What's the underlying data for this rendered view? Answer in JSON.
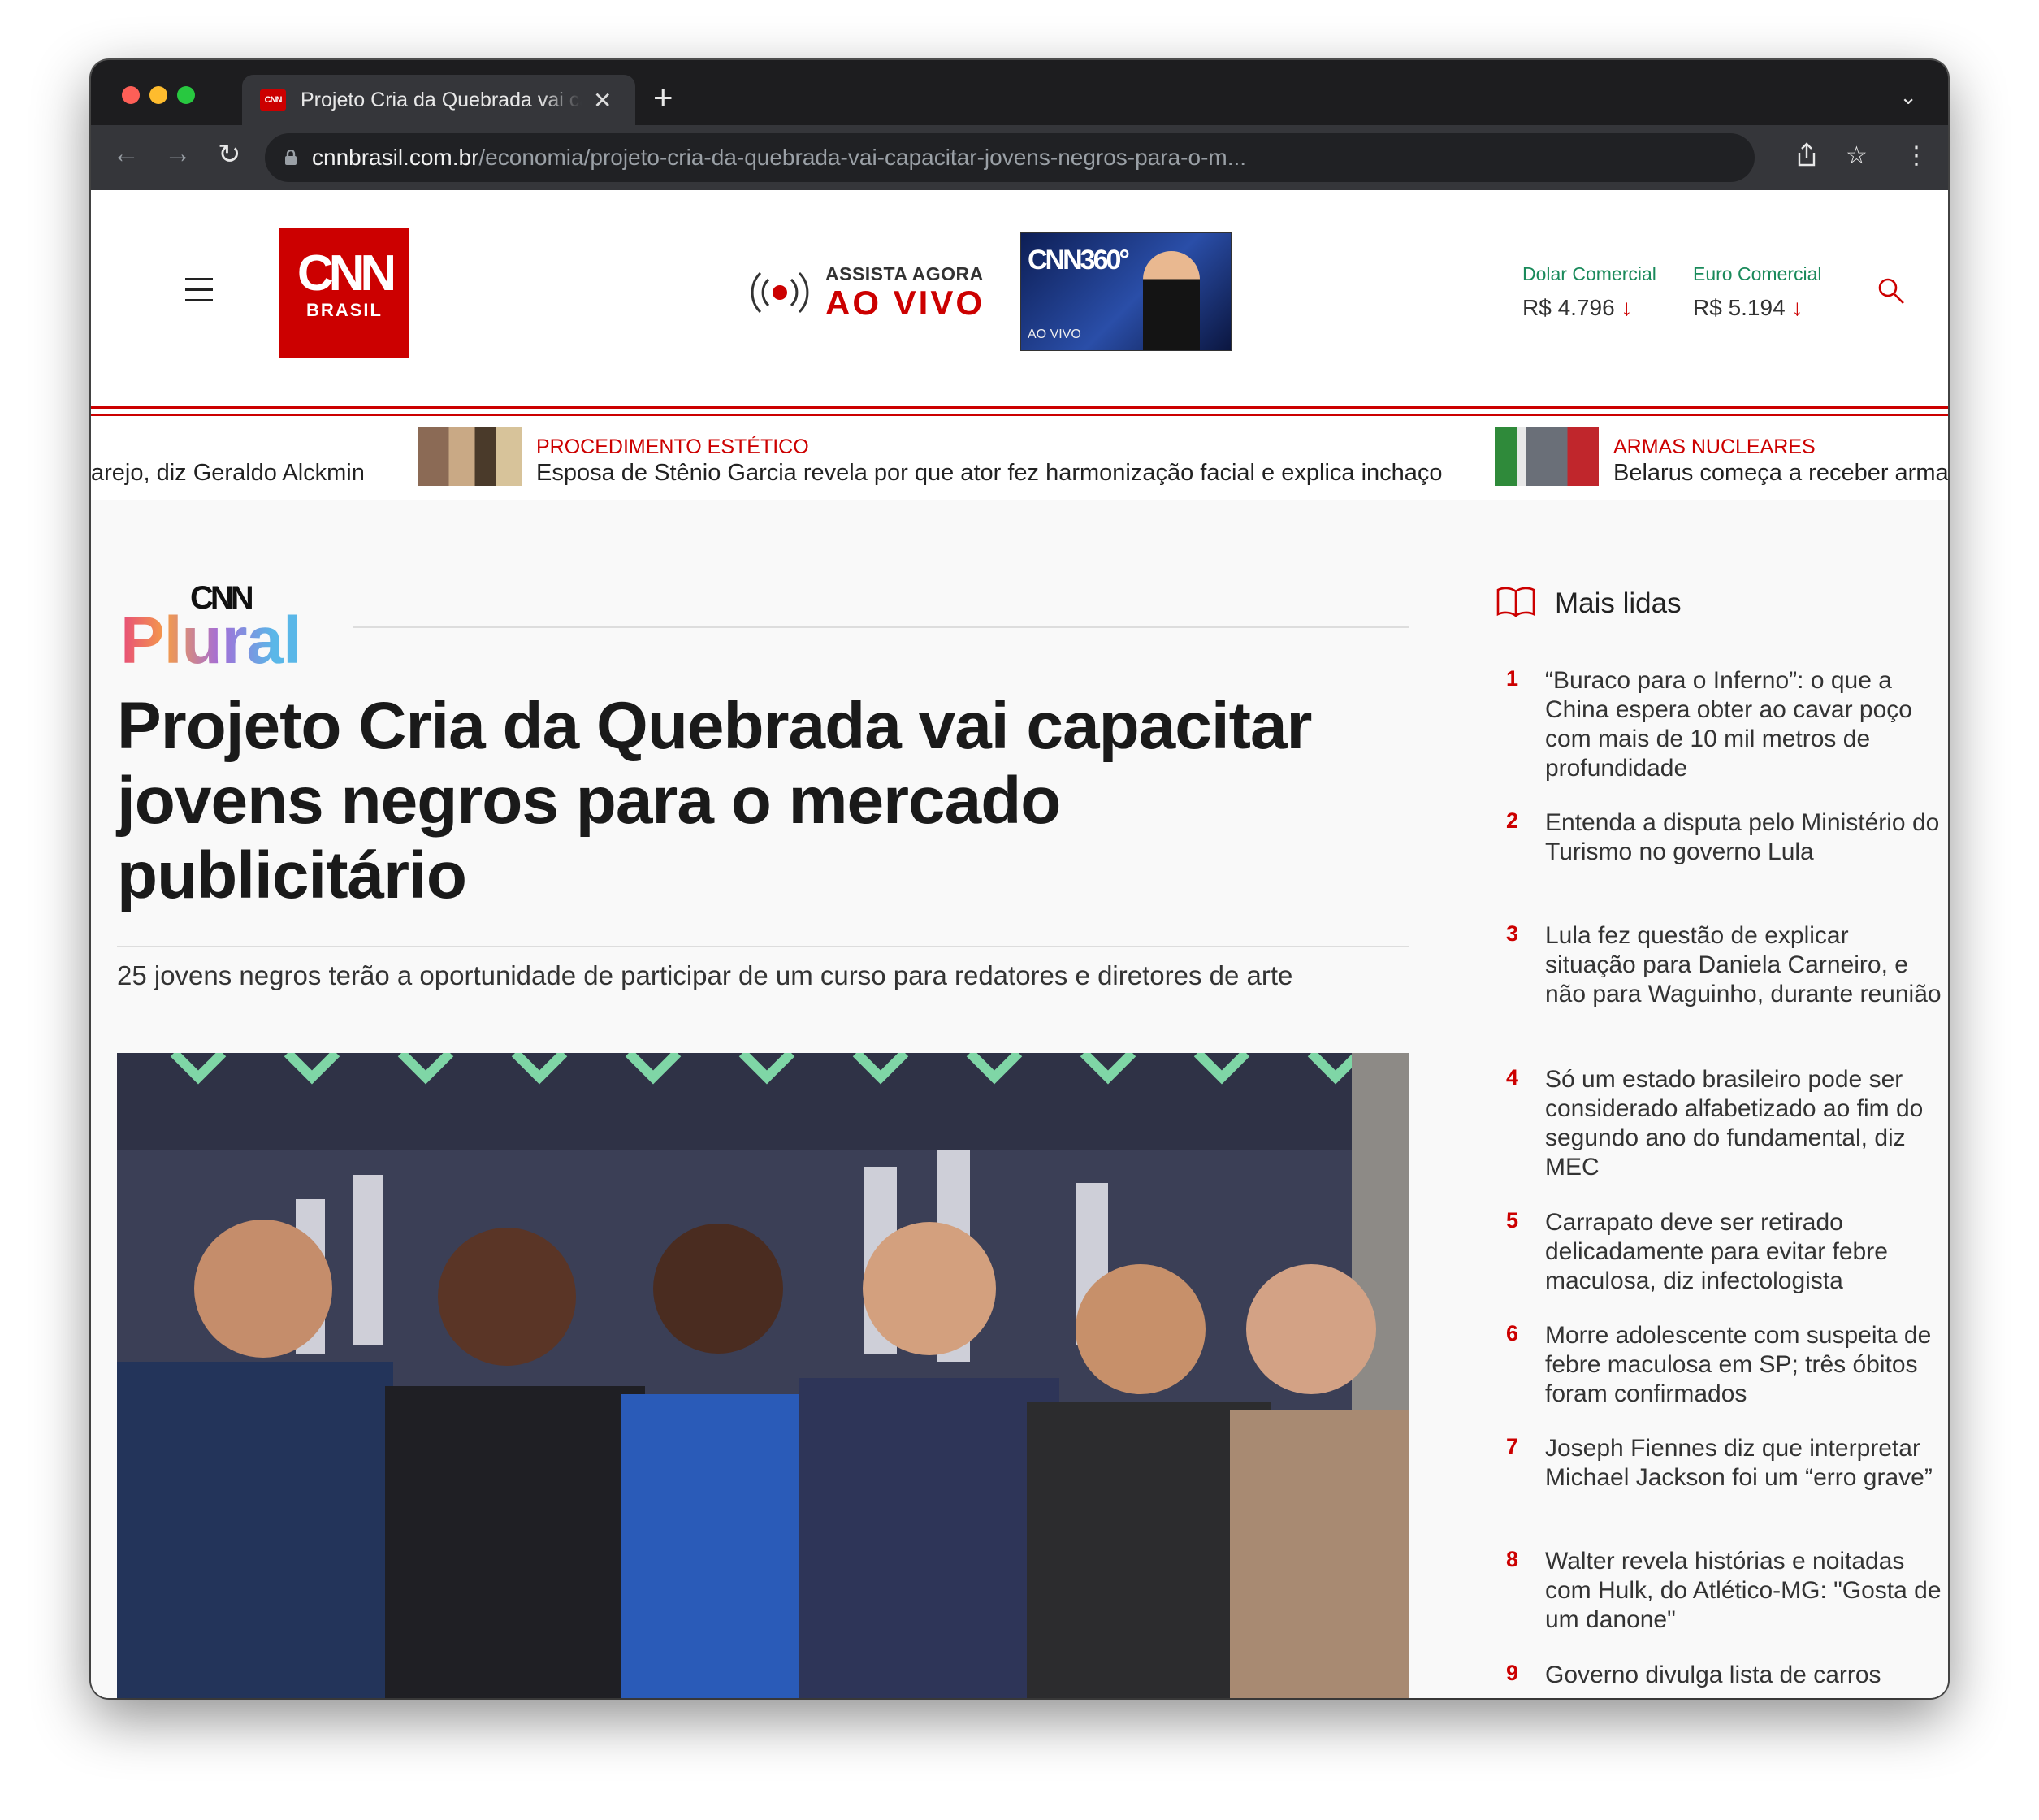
{
  "browser": {
    "tab_title": "Projeto Cria da Quebrada vai capacitar jovens negros para o mercado publicitário",
    "url_domain": "cnnbrasil.com.br",
    "url_path": "/economia/projeto-cria-da-quebrada-vai-capacitar-jovens-negros-para-o-m..."
  },
  "header": {
    "logo_top": "CNN",
    "logo_bottom": "BRASIL",
    "live_kicker": "ASSISTA AGORA",
    "live_label": "AO VIVO",
    "thumb_brand": "CNN360°",
    "thumb_tag": "AO VIVO",
    "currencies": [
      {
        "label": "Dolar Comercial",
        "value": "R$ 4.796",
        "trend": "down"
      },
      {
        "label": "Euro Comercial",
        "value": "R$ 5.194",
        "trend": "down"
      }
    ],
    "trend_glyph": "↓"
  },
  "ticker": [
    {
      "category": "",
      "headline": "arejo, diz Geraldo Alckmin"
    },
    {
      "category": "PROCEDIMENTO ESTÉTICO",
      "headline": "Esposa de Stênio Garcia revela por que ator fez harmonização facial e explica inchaço"
    },
    {
      "category": "ARMAS NUCLEARES",
      "headline": "Belarus começa a receber armas"
    }
  ],
  "article": {
    "section_brand_top": "CNN",
    "section_brand": "Plural",
    "title": "Projeto Cria da Quebrada vai capacitar jovens negros para o mercado publicitário",
    "subtitle": "25 jovens negros terão a oportunidade de participar de um curso para redatores e diretores de arte"
  },
  "most_read": {
    "title": "Mais lidas",
    "items": [
      {
        "n": "1",
        "text": "“Buraco para o Inferno”: o que a China espera obter ao cavar poço com mais de 10 mil metros de profundidade"
      },
      {
        "n": "2",
        "text": "Entenda a disputa pelo Ministério do Turismo no governo Lula"
      },
      {
        "n": "3",
        "text": "Lula fez questão de explicar situação para Daniela Carneiro, e não para Waguinho, durante reunião"
      },
      {
        "n": "4",
        "text": "Só um estado brasileiro pode ser considerado alfabetizado ao fim do segundo ano do fundamental, diz MEC"
      },
      {
        "n": "5",
        "text": "Carrapato deve ser retirado delicadamente para evitar febre maculosa, diz infectologista"
      },
      {
        "n": "6",
        "text": "Morre adolescente com suspeita de febre maculosa em SP; três óbitos foram confirmados"
      },
      {
        "n": "7",
        "text": "Joseph Fiennes diz que interpretar Michael Jackson foi um “erro grave”"
      },
      {
        "n": "8",
        "text": "Walter revela histórias e noitadas com Hulk, do Atlético-MG: \"Gosta de um danone\""
      },
      {
        "n": "9",
        "text": "Governo divulga lista de carros"
      }
    ]
  },
  "colors": {
    "brand_red": "#cc0000",
    "fx_green": "#1a8a5b"
  }
}
